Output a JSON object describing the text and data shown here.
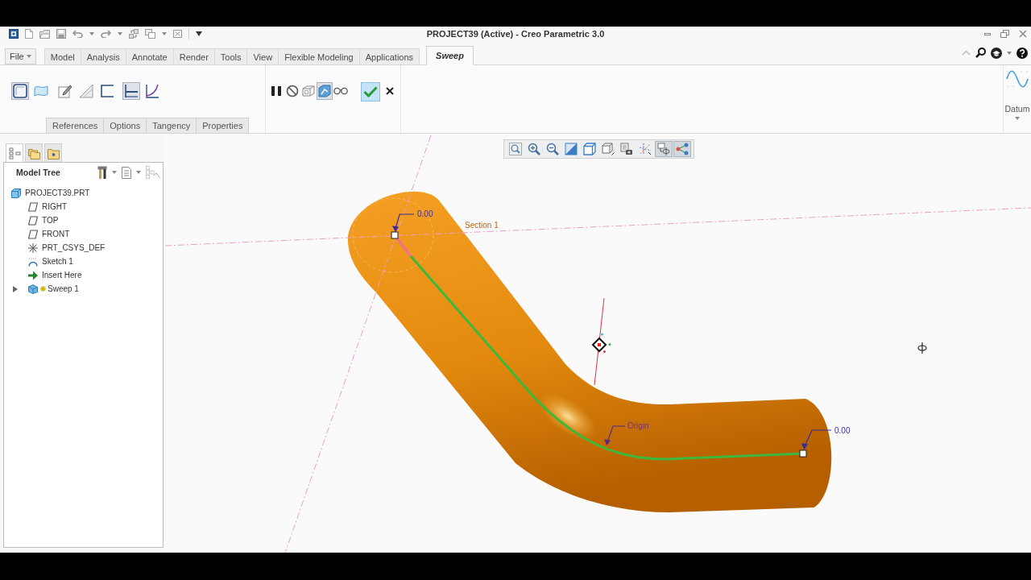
{
  "window": {
    "title": "PROJECT39 (Active) - Creo Parametric 3.0"
  },
  "ribbon_tabs": [
    {
      "label": "File",
      "kind": "menu",
      "selected": false
    },
    {
      "label": "Model",
      "kind": "tab",
      "selected": false
    },
    {
      "label": "Analysis",
      "kind": "tab",
      "selected": false
    },
    {
      "label": "Annotate",
      "kind": "tab",
      "selected": false
    },
    {
      "label": "Render",
      "kind": "tab",
      "selected": false
    },
    {
      "label": "Tools",
      "kind": "tab",
      "selected": false
    },
    {
      "label": "View",
      "kind": "tab",
      "selected": false
    },
    {
      "label": "Flexible Modeling",
      "kind": "tab",
      "selected": false
    },
    {
      "label": "Applications",
      "kind": "tab",
      "selected": false
    },
    {
      "label": "Sweep",
      "kind": "tab",
      "selected": true
    }
  ],
  "ribbon": {
    "tool_groups": [
      {
        "tools": [
          {
            "kind": "solid",
            "pressed": true
          },
          {
            "kind": "surface",
            "pressed": false
          }
        ]
      },
      {
        "tools": [
          {
            "kind": "sketch",
            "pressed": false
          },
          {
            "kind": "remove",
            "pressed": false
          },
          {
            "kind": "thicken",
            "pressed": false
          }
        ]
      },
      {
        "tools": [
          {
            "kind": "constant",
            "pressed": true
          },
          {
            "kind": "variable",
            "pressed": false
          }
        ]
      }
    ],
    "preview_tools": [
      {
        "kind": "pause",
        "pressed": false
      },
      {
        "kind": "no-preview",
        "pressed": false
      },
      {
        "kind": "wireframe",
        "pressed": false
      },
      {
        "kind": "verify",
        "pressed": true
      },
      {
        "kind": "glasses",
        "pressed": false
      }
    ],
    "panel_tabs": [
      {
        "label": "References",
        "selected": false
      },
      {
        "label": "Options",
        "selected": false
      },
      {
        "label": "Tangency",
        "selected": false
      },
      {
        "label": "Properties",
        "selected": false
      }
    ],
    "datum": {
      "label": "Datum"
    }
  },
  "view_toolbar": [
    {
      "kind": "refit",
      "pressed": false
    },
    {
      "kind": "zoom-in",
      "pressed": false
    },
    {
      "kind": "zoom-out",
      "pressed": false
    },
    {
      "kind": "repaint",
      "pressed": false
    },
    {
      "kind": "display-style",
      "pressed": false
    },
    {
      "kind": "saved-views",
      "pressed": false
    },
    {
      "kind": "view-manager",
      "pressed": false
    },
    {
      "kind": "datum-display",
      "pressed": false
    },
    {
      "kind": "spin-center",
      "pressed": true
    },
    {
      "kind": "annotations",
      "pressed": true
    }
  ],
  "model_tree": {
    "tabs": [
      {
        "kind": "tree",
        "selected": true
      },
      {
        "kind": "folders",
        "selected": false
      },
      {
        "kind": "favorites",
        "selected": false
      }
    ],
    "title": "Model Tree",
    "items": [
      {
        "label": "PROJECT39.PRT",
        "kind": "part",
        "children": [
          {
            "label": "RIGHT",
            "kind": "plane",
            "editing": false
          },
          {
            "label": "TOP",
            "kind": "plane",
            "editing": false
          },
          {
            "label": "FRONT",
            "kind": "plane",
            "editing": false
          },
          {
            "label": "PRT_CSYS_DEF",
            "kind": "csys",
            "editing": false
          },
          {
            "label": "Sketch 1",
            "kind": "sketch",
            "editing": false
          },
          {
            "label": "Insert Here",
            "kind": "insert",
            "editing": false
          },
          {
            "label": "Sweep 1",
            "kind": "sweep",
            "editing": true,
            "expanded": false
          }
        ]
      }
    ]
  },
  "viewport": {
    "labels": [
      {
        "text": "0.00",
        "kind": "dimension"
      },
      {
        "text": "Section 1",
        "kind": "section"
      },
      {
        "text": "Origin",
        "kind": "origin"
      },
      {
        "text": "0.00",
        "kind": "dimension"
      }
    ]
  }
}
